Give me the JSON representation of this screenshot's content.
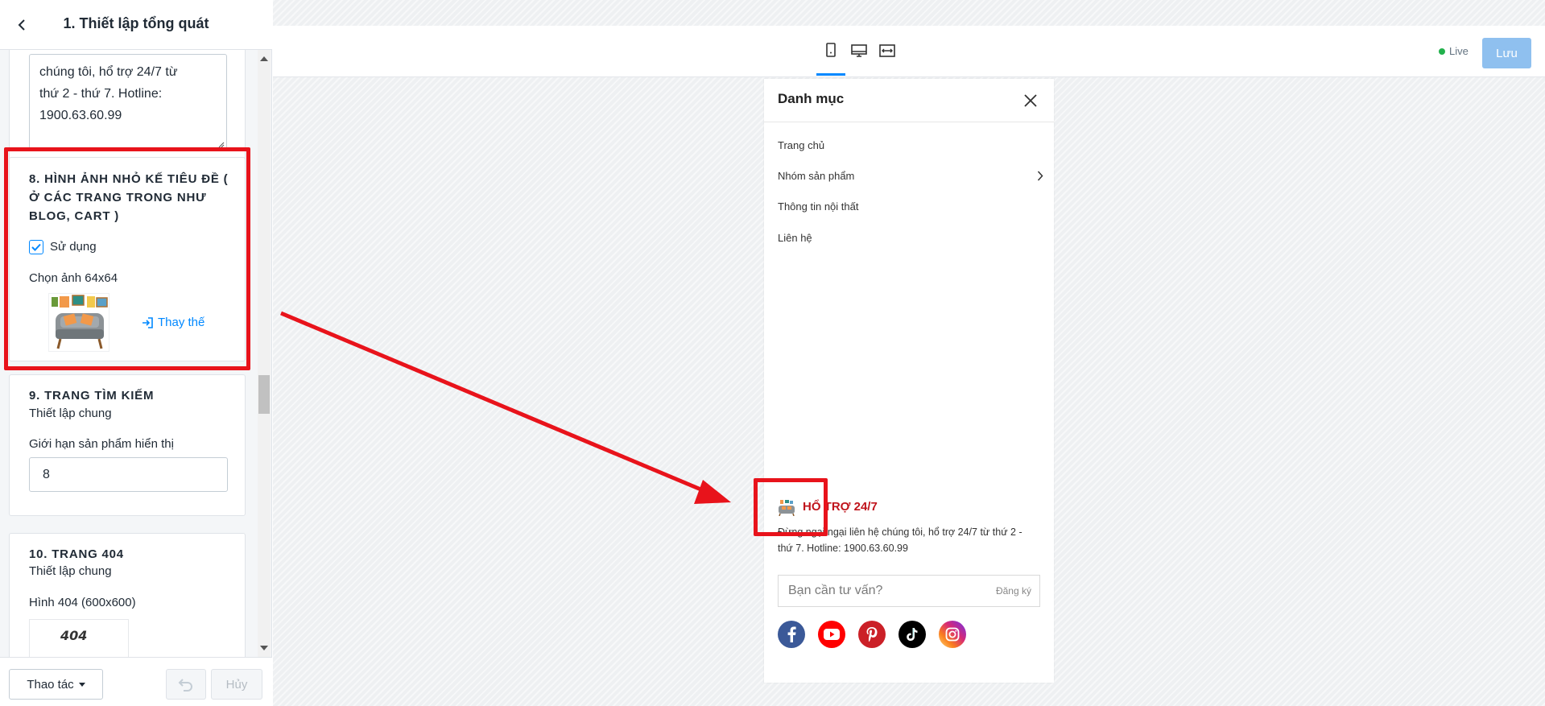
{
  "left_panel": {
    "title": "1. Thiết lập tổng quát",
    "textarea_lines": [
      "chúng tôi, hổ trợ 24/7 từ",
      "thứ 2 - thứ 7. Hotline:",
      "1900.63.60.99"
    ],
    "section8": {
      "heading_lines": [
        "8. HÌNH ẢNH NHỎ KẾ TIÊU ĐỀ (",
        "Ở CÁC TRANG TRONG NHƯ",
        "BLOG, CART )"
      ],
      "checkbox_label": "Sử dụng",
      "checked": true,
      "image_label": "Chọn ảnh 64x64",
      "replace_label": "Thay thế"
    },
    "section9": {
      "heading": "9. TRANG TÌM KIẾM",
      "subtitle": "Thiết lập chung",
      "field_label": "Giới hạn sản phẩm hiển thị",
      "field_value": "8"
    },
    "section10": {
      "heading": "10. TRANG 404",
      "subtitle": "Thiết lập chung",
      "field_label": "Hình 404 (600x600)",
      "thumb_text": "404"
    },
    "footer": {
      "actions_label": "Thao tác",
      "cancel_label": "Hủy"
    }
  },
  "toolbar": {
    "devices": [
      "mobile-icon",
      "desktop-icon",
      "fullwidth-icon"
    ],
    "active_device": "mobile",
    "live_label": "Live",
    "save_label": "Lưu"
  },
  "preview": {
    "title": "Danh mục",
    "menu": [
      {
        "label": "Trang chủ",
        "has_children": false
      },
      {
        "label": "Nhóm sản phẩm",
        "has_children": true
      },
      {
        "label": "Thông tin nội thất",
        "has_children": false
      },
      {
        "label": "Liên hệ",
        "has_children": false
      }
    ],
    "support_title": "HỔ TRỢ 24/7",
    "support_text": "Đừng ngại ngại liên hệ chúng tôi, hổ trợ 24/7 từ thứ 2 - thứ 7. Hotline: 1900.63.60.99",
    "input_placeholder": "Bạn cần tư vấn?",
    "submit_label": "Đăng ký",
    "social": [
      {
        "name": "facebook-icon",
        "color": "#3b5998"
      },
      {
        "name": "youtube-icon",
        "color": "#ff0000"
      },
      {
        "name": "pinterest-icon",
        "color": "#cb2027"
      },
      {
        "name": "tiktok-icon",
        "color": "#000000"
      },
      {
        "name": "instagram-icon",
        "color": "#c13584"
      }
    ]
  },
  "colors": {
    "accent": "#0088ff",
    "annotation_red": "#e8131b",
    "support_red": "#c0141c",
    "save_button": "#8fc0ef"
  }
}
